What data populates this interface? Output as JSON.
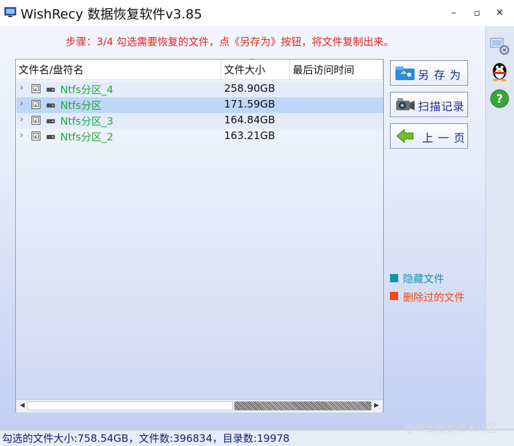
{
  "window": {
    "title": "WishRecy 数据恢复软件v3.85",
    "minimize": "–",
    "maximize": "▫",
    "close": "✕"
  },
  "step_text": "步骤：3/4 勾选需要恢复的文件，点《另存为》按钮，将文件复制出来。",
  "columns": [
    "文件名/盘符名",
    "文件大小",
    "最后访问时间"
  ],
  "sort_indicator": "˅",
  "rows": [
    {
      "name": "Ntfs分区_4",
      "size": "258.90GB",
      "checked": "☑"
    },
    {
      "name": "Ntfs分区",
      "size": "171.59GB",
      "checked": "☑"
    },
    {
      "name": "Ntfs分区_3",
      "size": "164.84GB",
      "checked": "☑"
    },
    {
      "name": "Ntfs分区_2",
      "size": "163.21GB",
      "checked": "☑"
    }
  ],
  "row_expand_glyph": "›",
  "buttons": {
    "save_as": "另 存 为",
    "scan_record": "扫描记录",
    "prev_page": "上 一 页"
  },
  "legend": [
    {
      "label": "隐藏文件",
      "color": "#1893a6"
    },
    {
      "label": "删除过的文件",
      "color": "#f04a0c"
    }
  ],
  "status": "勾选的文件大小:758.54GB，文件数:396834，目录数:19978",
  "watermark": "@稀土掘金技术社区",
  "scroll": {
    "left": "◀",
    "right": "▶"
  },
  "colors": {
    "partition_text": "#1ea93b",
    "step_text": "#e0261c",
    "button_text": "#1b2a8a"
  },
  "side_icons": [
    "network-settings-icon",
    "qq-penguin-icon",
    "help-question-icon"
  ]
}
